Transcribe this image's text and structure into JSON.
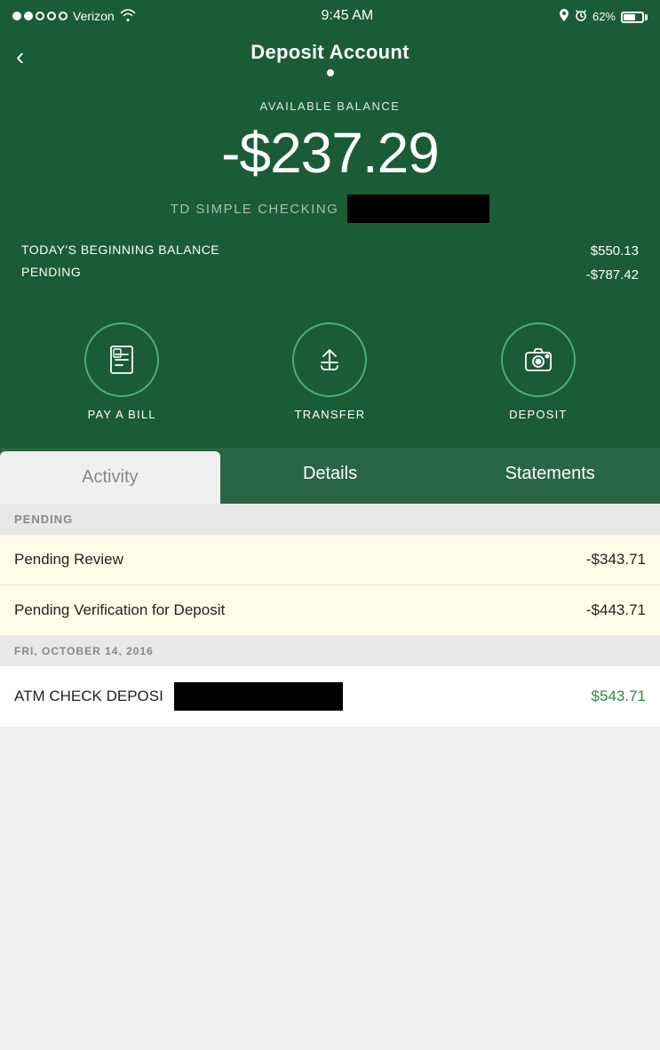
{
  "statusBar": {
    "carrier": "Verizon",
    "time": "9:45 AM",
    "battery": "62%",
    "signal_dots": [
      true,
      true,
      false,
      false,
      false
    ]
  },
  "header": {
    "title": "Deposit Account",
    "back_label": "‹"
  },
  "balance": {
    "available_label": "AVAILABLE BALANCE",
    "amount": "-$237.29",
    "account_name": "TD SIMPLE CHECKING",
    "beginning_balance_label": "TODAY'S BEGINNING BALANCE",
    "beginning_balance_value": "$550.13",
    "pending_label": "PENDING",
    "pending_value": "-$787.42"
  },
  "actions": [
    {
      "id": "pay-bill",
      "label": "PAY A BILL",
      "icon": "bill"
    },
    {
      "id": "transfer",
      "label": "TRANSFER",
      "icon": "transfer"
    },
    {
      "id": "deposit",
      "label": "DEPOSIT",
      "icon": "camera"
    }
  ],
  "tabs": [
    {
      "id": "activity",
      "label": "Activity",
      "active": true
    },
    {
      "id": "details",
      "label": "Details",
      "active": false
    },
    {
      "id": "statements",
      "label": "Statements",
      "active": false
    }
  ],
  "activity": {
    "pending_section_label": "PENDING",
    "pending_rows": [
      {
        "label": "Pending Review",
        "amount": "-$343.71"
      },
      {
        "label": "Pending Verification for Deposit",
        "amount": "-$443.71"
      }
    ],
    "date_section_label": "FRI, OCTOBER 14, 2016",
    "atm_label": "ATM CHECK DEPOSI",
    "atm_amount": "$543.71"
  }
}
